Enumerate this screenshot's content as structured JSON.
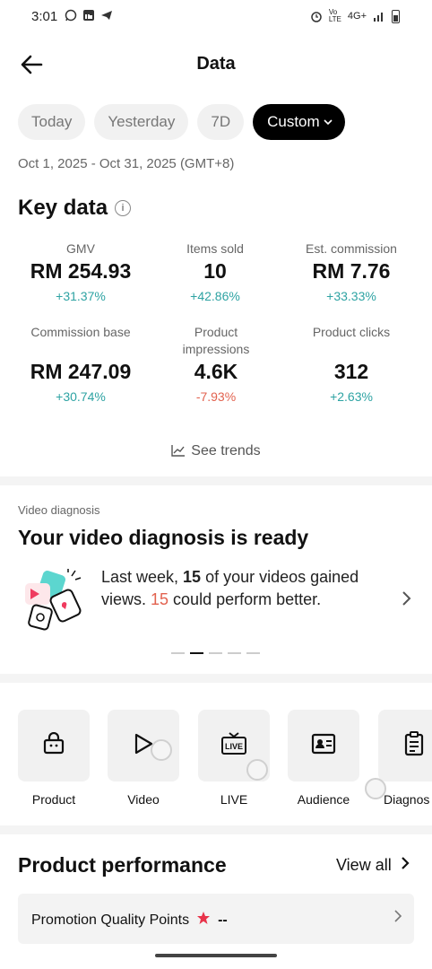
{
  "status": {
    "time": "3:01",
    "network": "4G+"
  },
  "header": {
    "title": "Data"
  },
  "filters": {
    "chips": [
      "Today",
      "Yesterday",
      "7D",
      "Custom"
    ],
    "active": "Custom",
    "date_range": "Oct 1, 2025 - Oct 31, 2025 (GMT+8)"
  },
  "key_data": {
    "title": "Key data",
    "metrics": [
      {
        "label": "GMV",
        "value": "RM 254.93",
        "change": "+31.37%"
      },
      {
        "label": "Items sold",
        "value": "10",
        "change": "+42.86%"
      },
      {
        "label": "Est. commission",
        "value": "RM 7.76",
        "change": "+33.33%"
      },
      {
        "label": "Commission base",
        "value": "RM 247.09",
        "change": "+30.74%"
      },
      {
        "label": "Product impressions",
        "value": "4.6K",
        "change": "-7.93%"
      },
      {
        "label": "Product clicks",
        "value": "312",
        "change": "+2.63%"
      }
    ],
    "see_trends": "See trends"
  },
  "video_diagnosis": {
    "label": "Video diagnosis",
    "title": "Your video diagnosis is ready",
    "text_before": "Last week, ",
    "count_gained": "15",
    "text_middle": " of your videos gained views. ",
    "count_better": "15",
    "text_after": " could perform better.",
    "carousel_pages": 5,
    "carousel_active": 2
  },
  "tools": [
    {
      "label": "Product",
      "icon": "shopping-bag-icon"
    },
    {
      "label": "Video",
      "icon": "play-icon"
    },
    {
      "label": "LIVE",
      "icon": "live-tv-icon"
    },
    {
      "label": "Audience",
      "icon": "id-card-icon"
    },
    {
      "label": "Diagnos",
      "icon": "clipboard-icon"
    }
  ],
  "product_performance": {
    "title": "Product performance",
    "view_all": "View all",
    "pqp_label": "Promotion Quality Points",
    "pqp_value": "--"
  },
  "colors": {
    "positive": "#2ea3a3",
    "negative": "#e2624f",
    "star": "#e8334a"
  }
}
